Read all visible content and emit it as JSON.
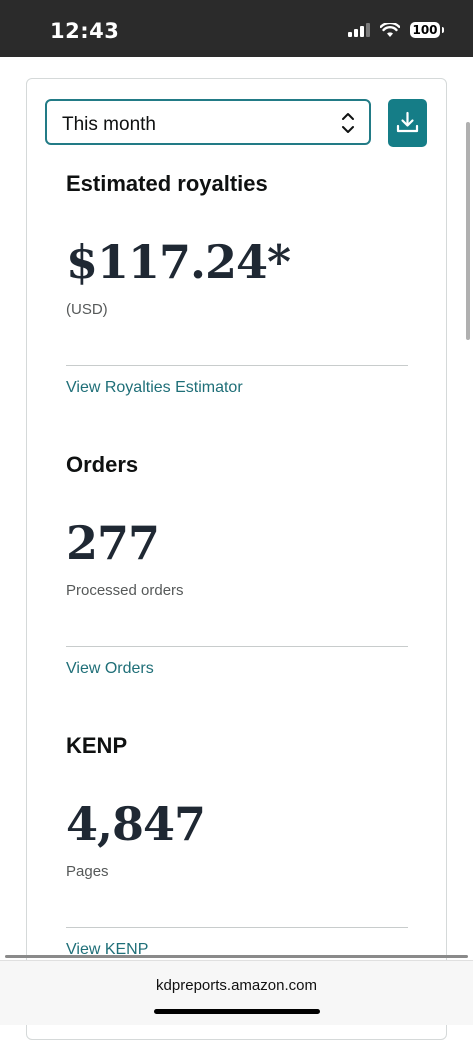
{
  "status_bar": {
    "time": "12:43",
    "battery": "100"
  },
  "period_select": {
    "value": "This month"
  },
  "royalties": {
    "title": "Estimated royalties",
    "amount": "$117.24*",
    "currency": "(USD)",
    "link": "View Royalties Estimator"
  },
  "orders": {
    "title": "Orders",
    "count": "277",
    "caption": "Processed orders",
    "link": "View Orders"
  },
  "kenp": {
    "title": "KENP",
    "count": "4,847",
    "caption": "Pages",
    "link": "View KENP"
  },
  "browser": {
    "url": "kdpreports.amazon.com"
  },
  "colors": {
    "accent": "#157d87",
    "link": "#1f6f78",
    "text": "#0f1111"
  }
}
